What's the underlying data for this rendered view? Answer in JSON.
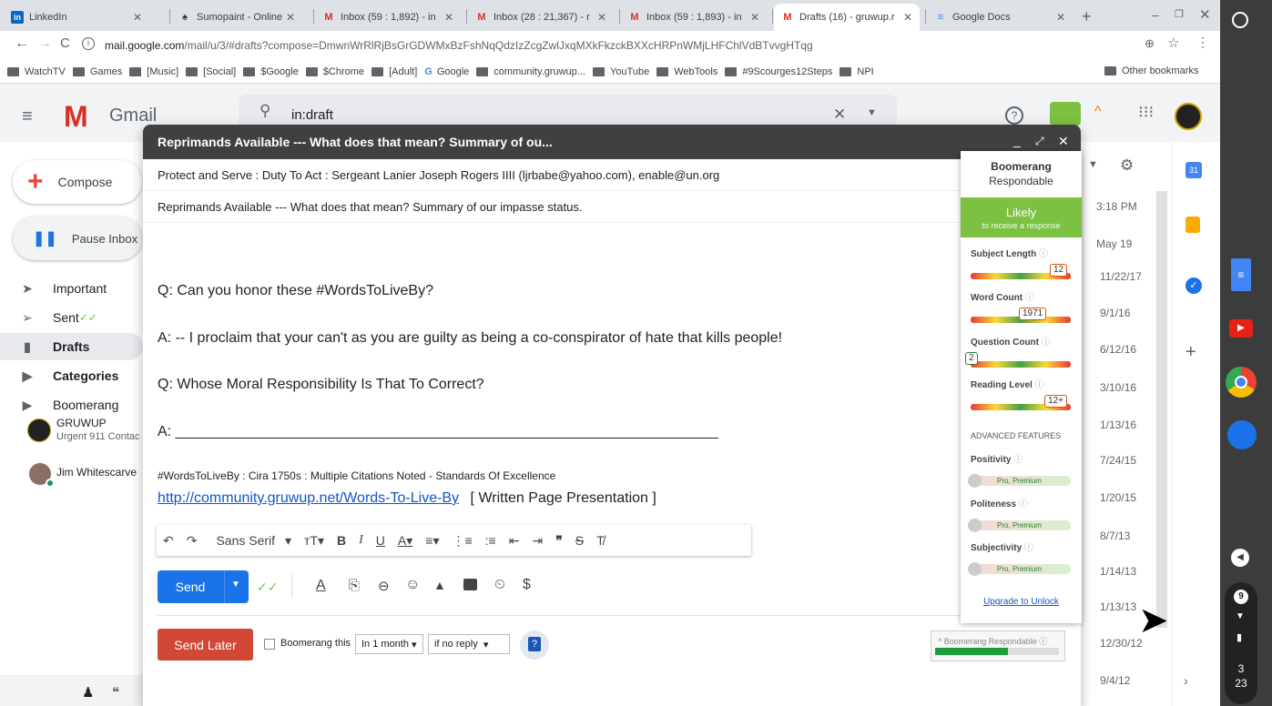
{
  "browser": {
    "tabs": [
      {
        "title": "LinkedIn",
        "icon": "linkedin-icon",
        "color": "#0a66c2",
        "glyph": "in"
      },
      {
        "title": "Sumopaint - Online Im",
        "icon": "sumopaint-icon",
        "color": "#333",
        "glyph": "♠"
      },
      {
        "title": "Inbox (59 : 1,892) - in",
        "icon": "gmail-icon",
        "color": "#d93025",
        "glyph": "M"
      },
      {
        "title": "Inbox (28 : 21,367) - r",
        "icon": "gmail-icon",
        "color": "#d93025",
        "glyph": "M"
      },
      {
        "title": "Inbox (59 : 1,893) - in",
        "icon": "gmail-icon",
        "color": "#d93025",
        "glyph": "M"
      },
      {
        "title": "Drafts (16) - gruwup.r",
        "icon": "gmail-icon",
        "color": "#d93025",
        "glyph": "M"
      },
      {
        "title": "Google Docs",
        "icon": "docs-icon",
        "color": "#4285f4",
        "glyph": "≡"
      }
    ],
    "new_tab": "+",
    "url_host": "mail.google.com",
    "url_path": "/mail/u/3/#drafts?compose=DmwnWrRlRjBsGrGDWMxBzFshNqQdzIzZcgZwlJxqMXkFkzckBXXcHRPnWMjLHFChlVdBTvvgHTqg",
    "bookmarks": [
      "WatchTV",
      "Games",
      "[Music]",
      "[Social]",
      "$Google",
      "$Chrome",
      "[Adult]",
      "Google",
      "community.gruwup...",
      "YouTube",
      "WebTools",
      "#9Scourges12Steps",
      "NPI"
    ],
    "other_bookmarks": "Other bookmarks"
  },
  "gmail": {
    "logo": "Gmail",
    "search_value": "in:draft",
    "compose_label": "Compose",
    "pause_label": "Pause Inbox",
    "sidebar": [
      "Important",
      "Sent",
      "Drafts",
      "Categories",
      "Boomerang"
    ],
    "hangouts": [
      {
        "name": "GRUWUP",
        "sub": "Urgent 911 Contac"
      },
      {
        "name": "Jim Whitescarve",
        "sub": ""
      }
    ],
    "dates": [
      "3:18 PM",
      "May 19",
      "11/22/17",
      "9/1/16",
      "6/12/16",
      "3/10/16",
      "1/13/16",
      "7/24/15",
      "1/20/15",
      "8/7/13",
      "1/14/13",
      "1/13/13",
      "12/30/12",
      "9/4/12"
    ]
  },
  "compose": {
    "title": "Reprimands Available --- What does that mean? Summary of ou...",
    "to": "Protect and Serve : Duty To Act : Sergeant Lanier Joseph Rogers IIII (ljrbabe@yahoo.com), enable@un.org",
    "subject": "Reprimands Available --- What does that mean?  Summary of our impasse status.",
    "body": {
      "q1": "Q:  Can you honor these #WordsToLiveBy?",
      "a1": "A: -- I proclaim that your can't as you are guilty as being a co-conspirator of hate that kills people!",
      "q2": "Q:  Whose Moral Responsibility Is That To Correct?",
      "a2": "A: ___________________________________________________________________",
      "sig": "#WordsToLiveBy : Cira 1750s : Multiple Citations Noted - Standards Of Excellence",
      "link": "http://community.gruwup.net/Words-To-Live-By",
      "link_after": "[ Written Page Presentation ]"
    },
    "font": "Sans Serif",
    "send": "Send",
    "send_later": "Send Later",
    "boomerang_this": "Boomerang this",
    "boom_time": "In 1 month",
    "boom_cond": "if no reply",
    "dollar": "$"
  },
  "boomerang": {
    "title": "Boomerang",
    "subtitle": "Respondable",
    "verdict": "Likely",
    "verdict_sub": "to receive a response",
    "metrics": [
      {
        "label": "Subject Length",
        "value": "12",
        "level": 0.95
      },
      {
        "label": "Word Count",
        "value": "1971",
        "level": 0.75
      },
      {
        "label": "Question Count",
        "value": "2",
        "level": 0.05
      },
      {
        "label": "Reading Level",
        "value": "12+",
        "level": 0.95
      }
    ],
    "advanced": "ADVANCED FEATURES",
    "locked": [
      "Positivity",
      "Politeness",
      "Subjectivity"
    ],
    "pro": "Pro, Premium",
    "upgrade": "Upgrade to Unlock",
    "footer": "Boomerang Respondable"
  },
  "system": {
    "notif": "9",
    "time_h": "3",
    "time_m": "23"
  }
}
